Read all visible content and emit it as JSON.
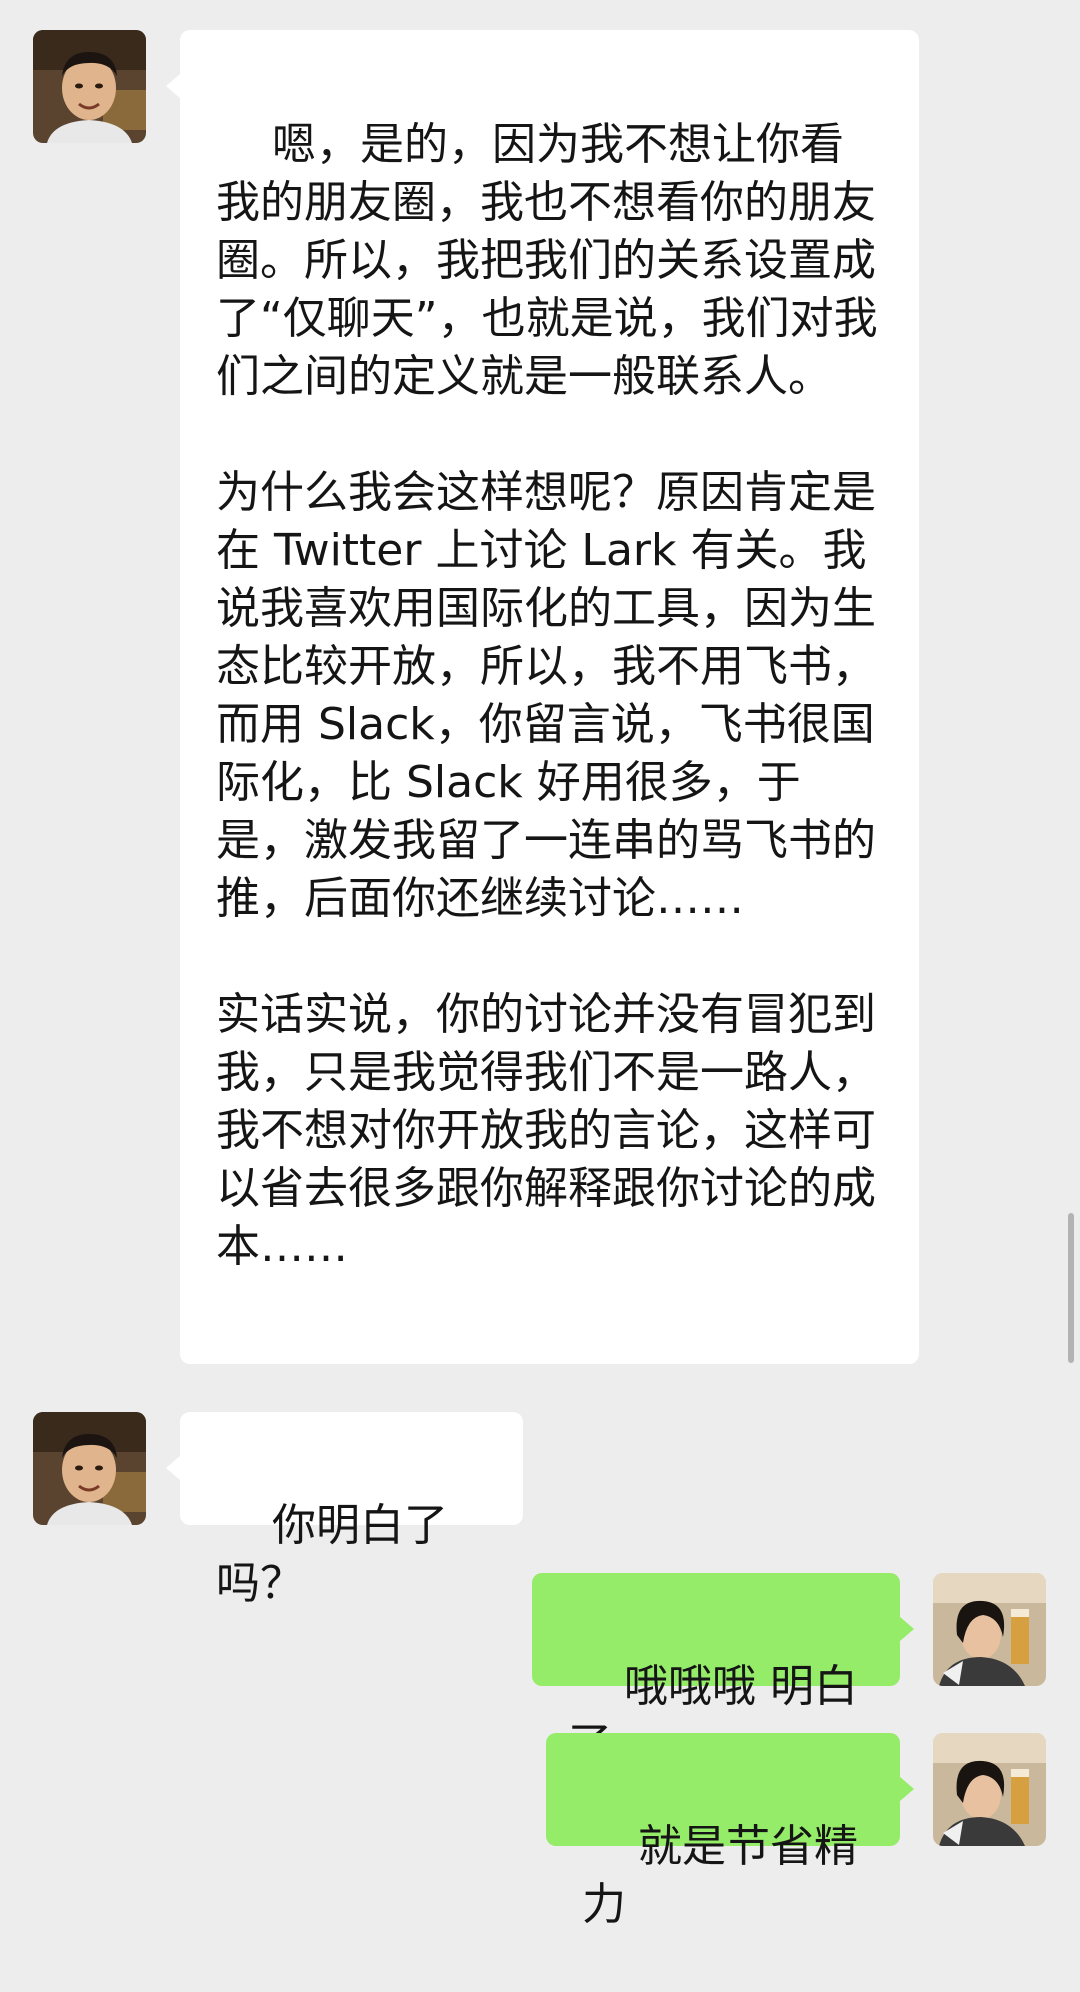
{
  "messages": [
    {
      "sender": "other",
      "text": "嗯，是的，因为我不想让你看我的朋友圈，我也不想看你的朋友圈。所以，我把我们的关系设置成了“仅聊天”，也就是说，我们对我们之间的定义就是一般联系人。\n\n为什么我会这样想呢？原因肯定是在 Twitter 上讨论 Lark 有关。我说我喜欢用国际化的工具，因为生态比较开放，所以，我不用飞书，而用 Slack，你留言说，飞书很国际化，比 Slack 好用很多，于是，激发我留了一连串的骂飞书的推，后面你还继续讨论……\n\n实话实说，你的讨论并没有冒犯到我，只是我觉得我们不是一路人，我不想对你开放我的言论，这样可以省去很多跟你解释跟你讨论的成本……"
    },
    {
      "sender": "other",
      "text": "你明白了吗？"
    },
    {
      "sender": "self",
      "text": "哦哦哦 明白了"
    },
    {
      "sender": "self",
      "text": "就是节省精力"
    }
  ],
  "colors": {
    "background": "#ededed",
    "incoming_bubble": "#ffffff",
    "outgoing_bubble": "#95ec69"
  }
}
